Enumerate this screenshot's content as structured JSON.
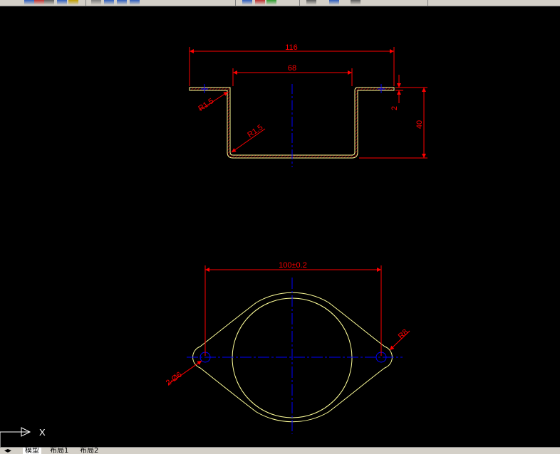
{
  "toolbar": {
    "icons": [
      "undo-icon",
      "redo-icon",
      "print-icon",
      "save-icon",
      "match-properties-icon",
      "pan-icon",
      "zoom-icon",
      "zoom-window-icon",
      "zoom-previous-icon",
      "properties-icon",
      "design-center-icon",
      "tool-palette-icon",
      "layer-icon",
      "text-style-icon",
      "dimension-style-icon"
    ]
  },
  "drawing": {
    "top_view": {
      "dim_overall_width": "116",
      "dim_inner_width": "68",
      "dim_flange_thickness": "2",
      "dim_height": "40",
      "radius_outer": "R1.5",
      "radius_inner": "R1.5"
    },
    "plan_view": {
      "dim_hole_spacing": "100±0.2",
      "dim_hole_count": "2-Ø6",
      "dim_radius": "R8"
    },
    "ucs": {
      "x_label": "X"
    },
    "colors": {
      "background": "#000000",
      "dimension": "#ff0000",
      "centerline": "#0000ff",
      "outline": "#ffff99",
      "hatch": "#ff0000",
      "ucs": "#ffffff"
    }
  },
  "tabs": [
    "模型",
    "布局1",
    "布局2"
  ]
}
